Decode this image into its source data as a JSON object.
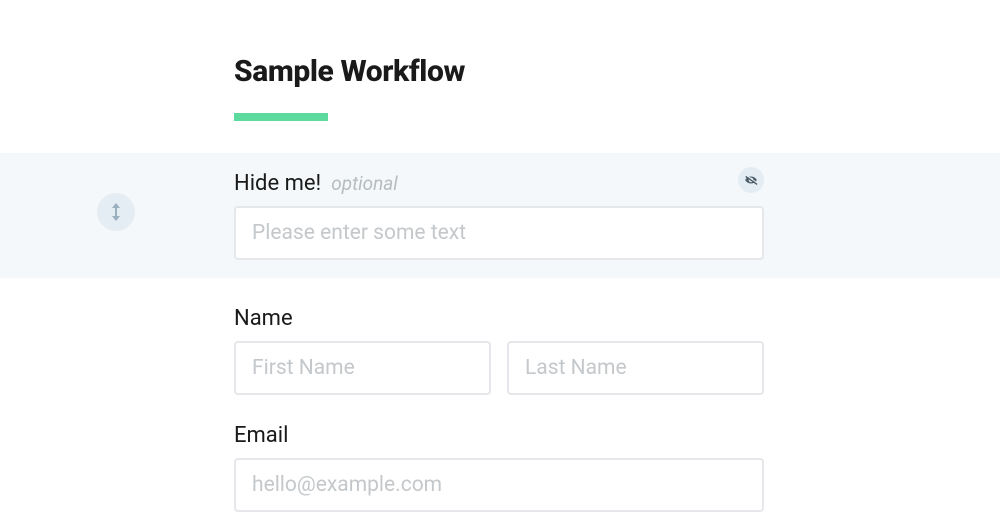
{
  "header": {
    "title": "Sample Workflow"
  },
  "fields": {
    "hideme": {
      "label": "Hide me!",
      "optional_text": "optional",
      "placeholder": "Please enter some text",
      "value": ""
    },
    "name": {
      "label": "Name",
      "first_placeholder": "First Name",
      "first_value": "",
      "last_placeholder": "Last Name",
      "last_value": ""
    },
    "email": {
      "label": "Email",
      "placeholder": "hello@example.com",
      "value": ""
    }
  },
  "colors": {
    "accent": "#5ddb9e",
    "highlight_bg": "#f5f8fa",
    "border": "#e5e7ea",
    "placeholder": "#c4c8cb"
  }
}
